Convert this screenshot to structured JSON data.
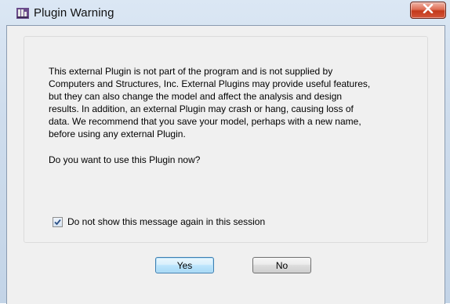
{
  "window": {
    "title": "Plugin Warning",
    "close_label": "Close"
  },
  "dialog": {
    "message": "This external Plugin is not part of the program and is not supplied by\nComputers and Structures, Inc.  External Plugins may provide useful features,\nbut they can also change the model and affect the analysis and design\nresults.  In addition, an external Plugin may crash or hang, causing loss of\ndata. We recommend that you save your model, perhaps with a new name,\nbefore using any external Plugin.",
    "question": "Do you want to use this Plugin now?",
    "checkbox_label": "Do not show this message again in this session",
    "checkbox_checked": true,
    "yes_label": "Yes",
    "no_label": "No"
  }
}
